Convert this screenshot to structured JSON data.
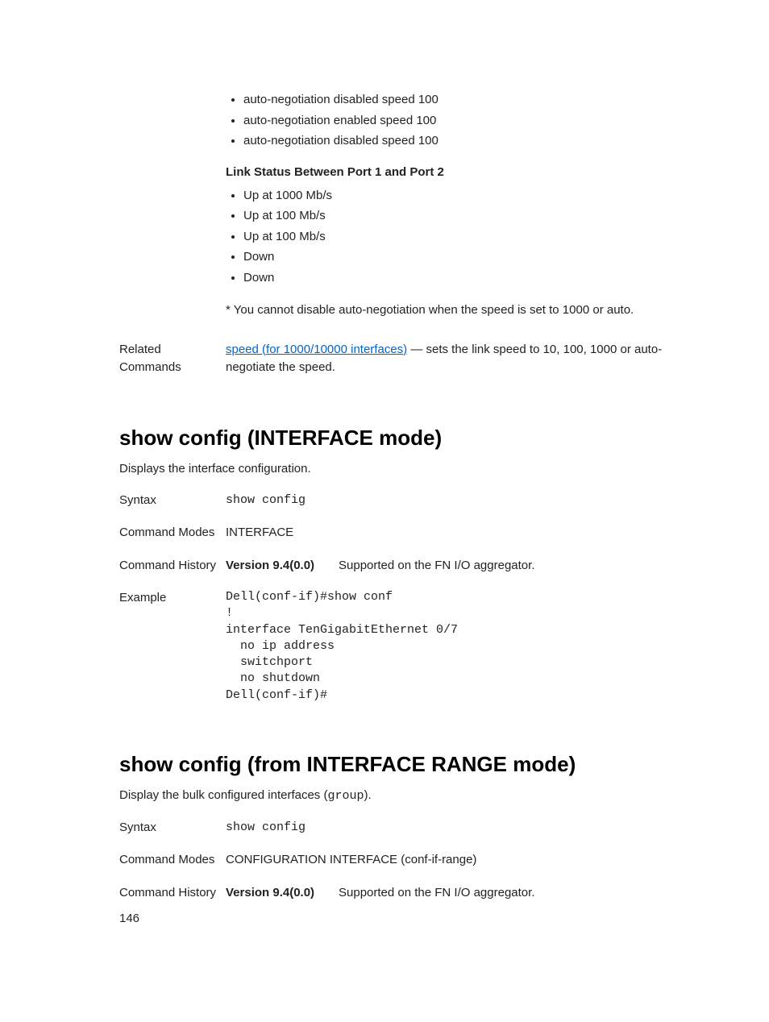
{
  "top_bullets": [
    "auto-negotiation disabled speed 100",
    "auto-negotiation enabled speed 100",
    "auto-negotiation disabled speed 100"
  ],
  "link_status_heading": "Link Status Between Port 1 and Port 2",
  "link_status_bullets": [
    "Up at 1000 Mb/s",
    "Up at 100 Mb/s",
    "Up at 100 Mb/s",
    "Down",
    "Down"
  ],
  "footnote": "* You cannot disable auto-negotiation when the speed is set to 1000 or auto.",
  "related": {
    "label": "Related Commands",
    "link_text": "speed (for 1000/10000 interfaces)",
    "rest": " — sets the link speed to 10, 100, 1000 or auto-negotiate the speed."
  },
  "sec1": {
    "title": "show config (INTERFACE mode)",
    "desc": "Displays the interface configuration.",
    "syntax_label": "Syntax",
    "syntax_value": "show config",
    "modes_label": "Command Modes",
    "modes_value": "INTERFACE",
    "history_label": "Command History",
    "version": "Version 9.4(0.0)",
    "version_desc": "Supported on the FN I/O aggregator.",
    "example_label": "Example",
    "example_code": "Dell(conf-if)#show conf\n!\ninterface TenGigabitEthernet 0/7\n  no ip address\n  switchport\n  no shutdown\nDell(conf-if)#"
  },
  "sec2": {
    "title": "show config (from INTERFACE RANGE mode)",
    "desc_pre": "Display the bulk configured interfaces (",
    "desc_code": "group",
    "desc_post": ").",
    "syntax_label": "Syntax",
    "syntax_value": "show config",
    "modes_label": "Command Modes",
    "modes_value": "CONFIGURATION INTERFACE (conf-if-range)",
    "history_label": "Command History",
    "version": "Version 9.4(0.0)",
    "version_desc": "Supported on the FN I/O aggregator."
  },
  "page_number": "146"
}
